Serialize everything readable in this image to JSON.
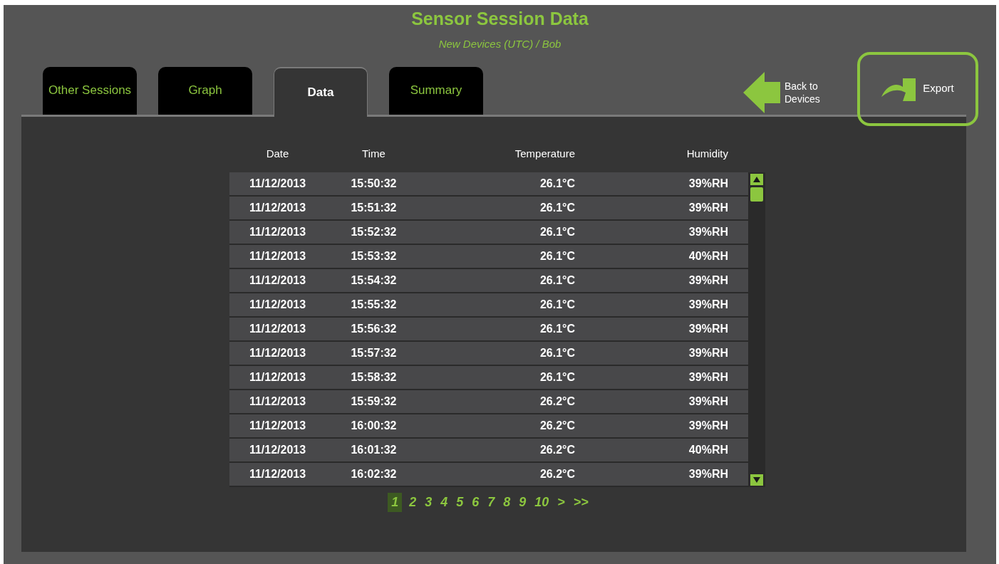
{
  "header": {
    "title": "Sensor Session Data",
    "subtitle": "New Devices  (UTC) / Bob"
  },
  "tabs": [
    {
      "label": "Other Sessions",
      "selected": false
    },
    {
      "label": "Graph",
      "selected": false
    },
    {
      "label": "Data",
      "selected": true
    },
    {
      "label": "Summary",
      "selected": false
    }
  ],
  "actions": {
    "back": "Back to Devices",
    "export": "Export"
  },
  "table": {
    "columns": [
      "Date",
      "Time",
      "Temperature",
      "Humidity"
    ],
    "rows": [
      [
        "11/12/2013",
        "15:50:32",
        "26.1°C",
        "39%RH"
      ],
      [
        "11/12/2013",
        "15:51:32",
        "26.1°C",
        "39%RH"
      ],
      [
        "11/12/2013",
        "15:52:32",
        "26.1°C",
        "39%RH"
      ],
      [
        "11/12/2013",
        "15:53:32",
        "26.1°C",
        "40%RH"
      ],
      [
        "11/12/2013",
        "15:54:32",
        "26.1°C",
        "39%RH"
      ],
      [
        "11/12/2013",
        "15:55:32",
        "26.1°C",
        "39%RH"
      ],
      [
        "11/12/2013",
        "15:56:32",
        "26.1°C",
        "39%RH"
      ],
      [
        "11/12/2013",
        "15:57:32",
        "26.1°C",
        "39%RH"
      ],
      [
        "11/12/2013",
        "15:58:32",
        "26.1°C",
        "39%RH"
      ],
      [
        "11/12/2013",
        "15:59:32",
        "26.2°C",
        "39%RH"
      ],
      [
        "11/12/2013",
        "16:00:32",
        "26.2°C",
        "39%RH"
      ],
      [
        "11/12/2013",
        "16:01:32",
        "26.2°C",
        "40%RH"
      ],
      [
        "11/12/2013",
        "16:02:32",
        "26.2°C",
        "39%RH"
      ]
    ]
  },
  "pagination": [
    {
      "label": "1",
      "selected": true
    },
    {
      "label": "2",
      "selected": false
    },
    {
      "label": "3",
      "selected": false
    },
    {
      "label": "4",
      "selected": false
    },
    {
      "label": "5",
      "selected": false
    },
    {
      "label": "6",
      "selected": false
    },
    {
      "label": "7",
      "selected": false
    },
    {
      "label": "8",
      "selected": false
    },
    {
      "label": "9",
      "selected": false
    },
    {
      "label": "10",
      "selected": false
    },
    {
      "label": ">",
      "selected": false
    },
    {
      "label": ">>",
      "selected": false
    }
  ]
}
